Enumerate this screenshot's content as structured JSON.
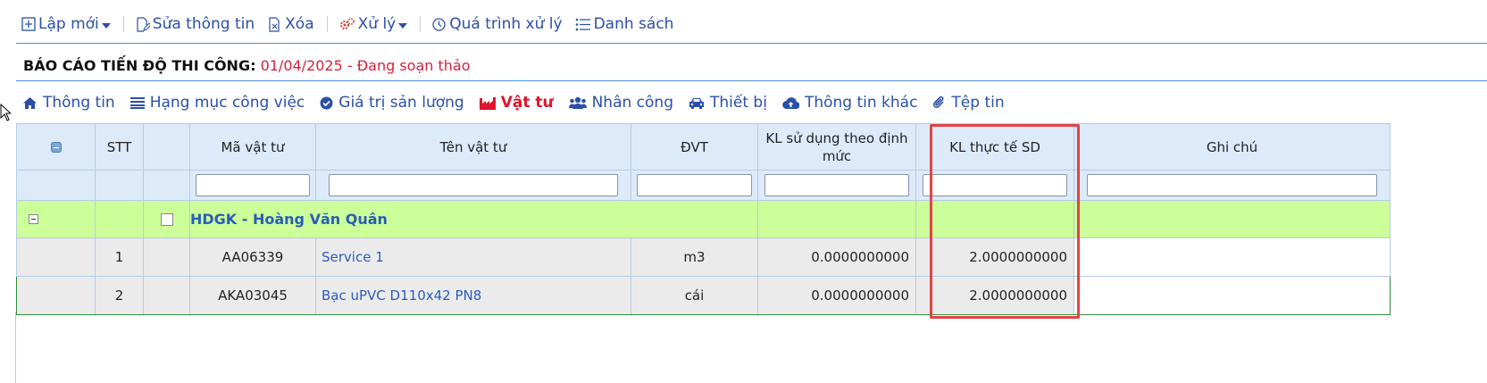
{
  "toolbar": {
    "new_label": "Lập mới",
    "edit_label": "Sửa thông tin",
    "delete_label": "Xóa",
    "process_label": "Xử lý",
    "history_label": "Quá trình xử lý",
    "list_label": "Danh sách"
  },
  "header": {
    "title_prefix": "BÁO CÁO TIẾN ĐỘ THI CÔNG:",
    "title_status": " 01/04/2025 - Đang soạn thảo"
  },
  "tabs": [
    {
      "label": "Thông tin",
      "icon": "home-icon"
    },
    {
      "label": "Hạng mục công việc",
      "icon": "list-icon"
    },
    {
      "label": "Giá trị sản lượng",
      "icon": "check-circle-icon"
    },
    {
      "label": "Vật tư",
      "icon": "factory-icon",
      "active": true
    },
    {
      "label": "Nhân công",
      "icon": "users-icon"
    },
    {
      "label": "Thiết bị",
      "icon": "car-icon"
    },
    {
      "label": "Thông tin khác",
      "icon": "cloud-upload-icon"
    },
    {
      "label": "Tệp tin",
      "icon": "paperclip-icon"
    }
  ],
  "grid": {
    "columns": {
      "stt": "STT",
      "code": "Mã vật tư",
      "name": "Tên vật tư",
      "unit": "ĐVT",
      "planned": "KL sử dụng theo định mức",
      "actual": "KL thực tế SD",
      "note": "Ghi chú"
    },
    "group": {
      "label": "HDGK - Hoàng Văn Quân"
    },
    "rows": [
      {
        "stt": "1",
        "code": "AA06339",
        "name": "Service 1",
        "unit": "m3",
        "planned": "0.0000000000",
        "actual": "2.0000000000",
        "note": ""
      },
      {
        "stt": "2",
        "code": "AKA03045",
        "name": "Bạc uPVC D110x42 PN8",
        "unit": "cái",
        "planned": "0.0000000000",
        "actual": "2.0000000000",
        "note": ""
      }
    ]
  },
  "colors": {
    "link": "#2b4fa8",
    "active_tab": "#e0142c",
    "status_text": "#d8203c",
    "group_row": "#ccff99",
    "header_bg": "#ddeafa",
    "highlight_box": "#e04448"
  }
}
